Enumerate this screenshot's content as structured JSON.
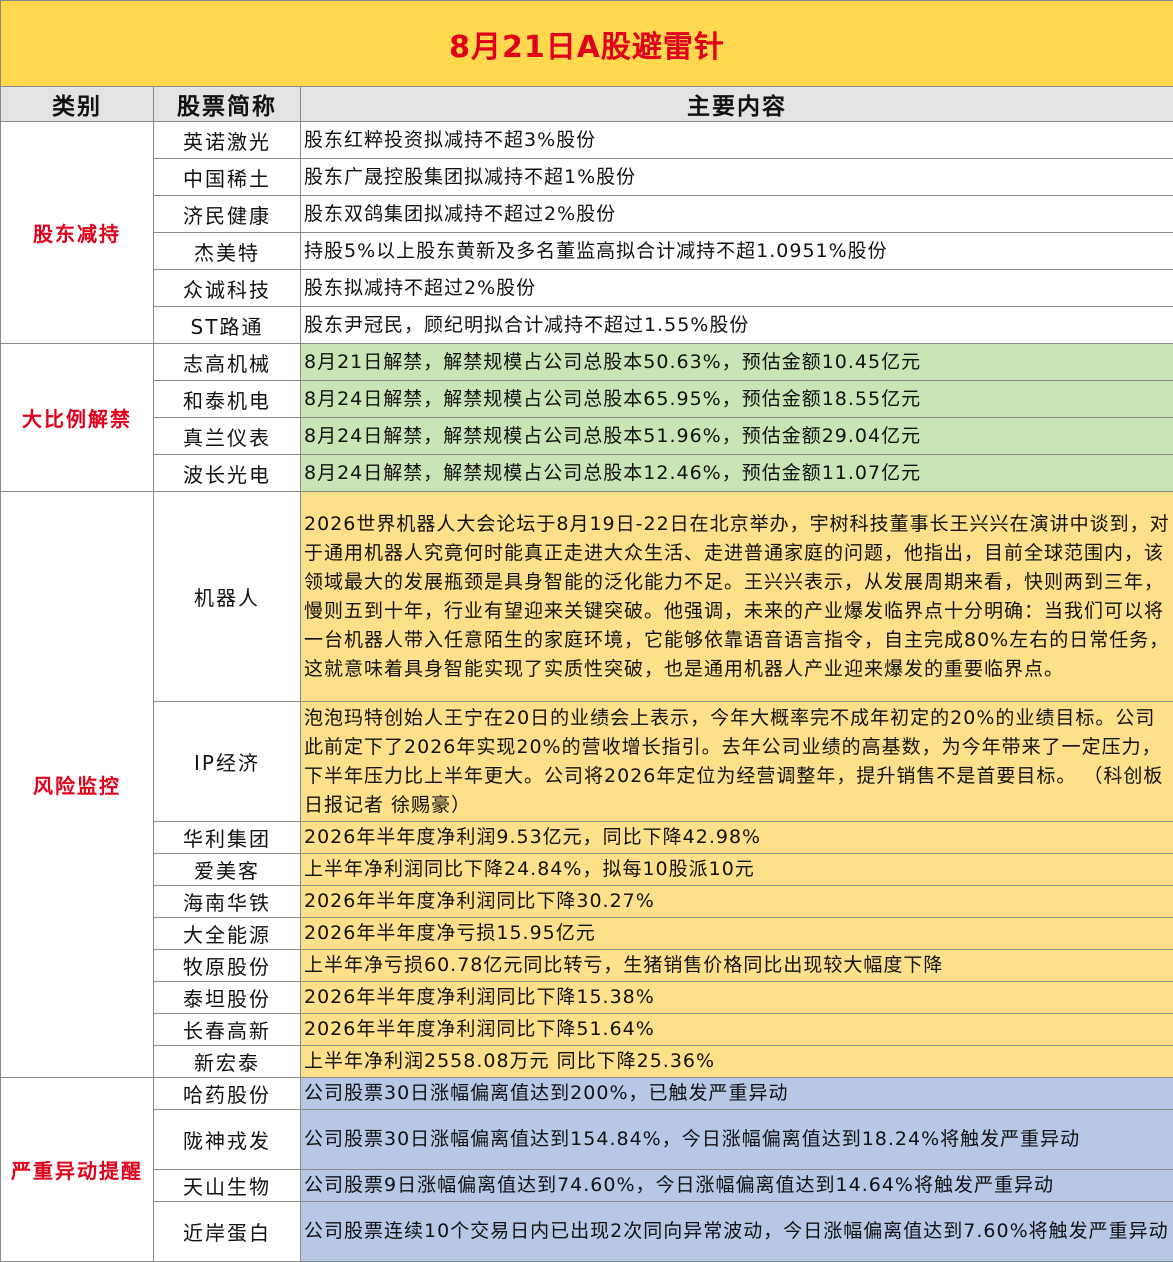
{
  "title": "8月21日A股避雷针",
  "header": {
    "category": "类别",
    "stock": "股票简称",
    "content": "主要内容"
  },
  "colors": {
    "title_bg": "#ffd84d",
    "title_text": "#e0001b",
    "green": "#c9e5b5",
    "yellow": "#ffe08a",
    "blue": "#b7c7e6"
  },
  "sections": [
    {
      "category": "股东减持",
      "rows": [
        {
          "stock": "英诺激光",
          "content": "股东红粹投资拟减持不超3%股份"
        },
        {
          "stock": "中国稀土",
          "content": "股东广晟控股集团拟减持不超1%股份"
        },
        {
          "stock": "济民健康",
          "content": "股东双鸽集团拟减持不超过2%股份"
        },
        {
          "stock": "杰美特",
          "content": "持股5%以上股东黄新及多名董监高拟合计减持不超1.0951%股份"
        },
        {
          "stock": "众诚科技",
          "content": "股东拟减持不超过2%股份"
        },
        {
          "stock": "ST路通",
          "content": "股东尹冠民，顾纪明拟合计减持不超过1.55%股份"
        }
      ]
    },
    {
      "category": "大比例解禁",
      "rows": [
        {
          "stock": "志高机械",
          "content": "8月21日解禁，解禁规模占公司总股本50.63%，预估金额10.45亿元"
        },
        {
          "stock": "和泰机电",
          "content": "8月24日解禁，解禁规模占公司总股本65.95%，预估金额18.55亿元"
        },
        {
          "stock": "真兰仪表",
          "content": "8月24日解禁，解禁规模占公司总股本51.96%，预估金额29.04亿元"
        },
        {
          "stock": "波长光电",
          "content": "8月24日解禁，解禁规模占公司总股本12.46%，预估金额11.07亿元"
        }
      ]
    },
    {
      "category": "风险监控",
      "rows": [
        {
          "stock": "机器人",
          "content": "2026世界机器人大会论坛于8月19日-22日在北京举办，宇树科技董事长王兴兴在演讲中谈到，对于通用机器人究竟何时能真正走进大众生活、走进普通家庭的问题，他指出，目前全球范围内，该领域最大的发展瓶颈是具身智能的泛化能力不足。王兴兴表示，从发展周期来看，快则两到三年，慢则五到十年，行业有望迎来关键突破。他强调，未来的产业爆发临界点十分明确：当我们可以将一台机器人带入任意陌生的家庭环境，它能够依靠语音语言指令，自主完成80%左右的日常任务，这就意味着具身智能实现了实质性突破，也是通用机器人产业迎来爆发的重要临界点。"
        },
        {
          "stock": "IP经济",
          "content": "泡泡玛特创始人王宁在20日的业绩会上表示，今年大概率完不成年初定的20%的业绩目标。公司此前定下了2026年实现20%的营收增长指引。去年公司业绩的高基数，为今年带来了一定压力，下半年压力比上半年更大。公司将2026年定位为经营调整年，提升销售不是首要目标。 （科创板日报记者 徐赐豪）"
        },
        {
          "stock": "华利集团",
          "content": "2026年半年度净利润9.53亿元，同比下降42.98%"
        },
        {
          "stock": "爱美客",
          "content": "上半年净利润同比下降24.84%，拟每10股派10元"
        },
        {
          "stock": "海南华铁",
          "content": "2026年半年度净利润同比下降30.27%"
        },
        {
          "stock": "大全能源",
          "content": "2026年半年度净亏损15.95亿元"
        },
        {
          "stock": "牧原股份",
          "content": "上半年净亏损60.78亿元同比转亏，生猪销售价格同比出现较大幅度下降"
        },
        {
          "stock": "泰坦股份",
          "content": "2026年半年度净利润同比下降15.38%"
        },
        {
          "stock": "长春高新",
          "content": "2026年半年度净利润同比下降51.64%"
        },
        {
          "stock": "新宏泰",
          "content": "上半年净利润2558.08万元 同比下降25.36%"
        }
      ]
    },
    {
      "category": "严重异动提醒",
      "rows": [
        {
          "stock": "哈药股份",
          "content": "公司股票30日涨幅偏离值达到200%，已触发严重异动"
        },
        {
          "stock": "陇神戎发",
          "content": "公司股票30日涨幅偏离值达到154.84%，今日涨幅偏离值达到18.24%将触发严重异动"
        },
        {
          "stock": "天山生物",
          "content": "公司股票9日涨幅偏离值达到74.60%，今日涨幅偏离值达到14.64%将触发严重异动"
        },
        {
          "stock": "近岸蛋白",
          "content": "公司股票连续10个交易日内已出现2次同向异常波动，今日涨幅偏离值达到7.60%将触发严重异动"
        }
      ]
    }
  ]
}
